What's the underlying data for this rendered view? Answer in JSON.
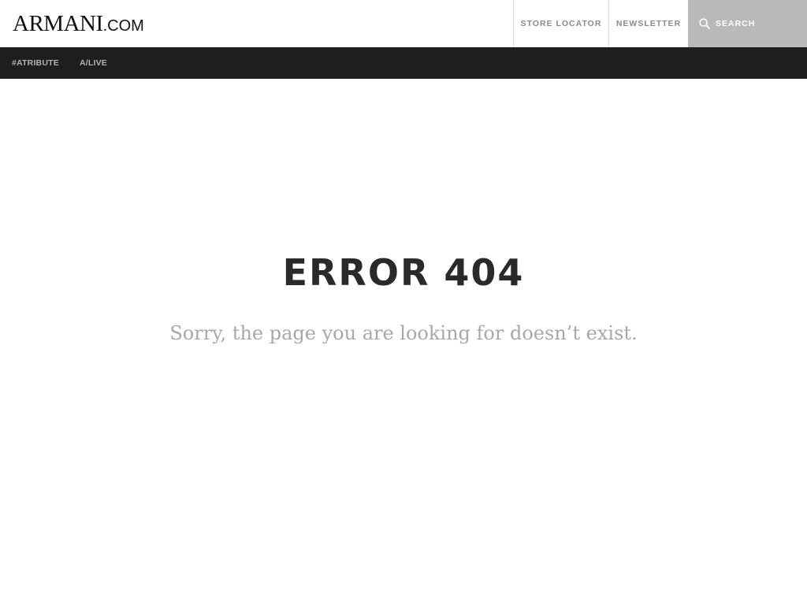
{
  "header": {
    "logo": {
      "main": "ARMANI",
      "suffix": ".COM"
    },
    "utility_nav": [
      {
        "label": "STORE LOCATOR"
      },
      {
        "label": "NEWSLETTER"
      }
    ],
    "search": {
      "label": "SEARCH",
      "icon": "search-icon"
    }
  },
  "main_nav": {
    "items": [
      {
        "label": "#ATRIBUTE"
      },
      {
        "label": "A/LIVE"
      }
    ]
  },
  "error": {
    "title": "ERROR 404",
    "message": "Sorry, the page you are looking for doesn’t exist."
  },
  "colors": {
    "nav_background": "#1e1e1e",
    "search_background": "#b9b9b9",
    "title_text": "#2a2a2a",
    "message_text": "#a8a8a8"
  }
}
